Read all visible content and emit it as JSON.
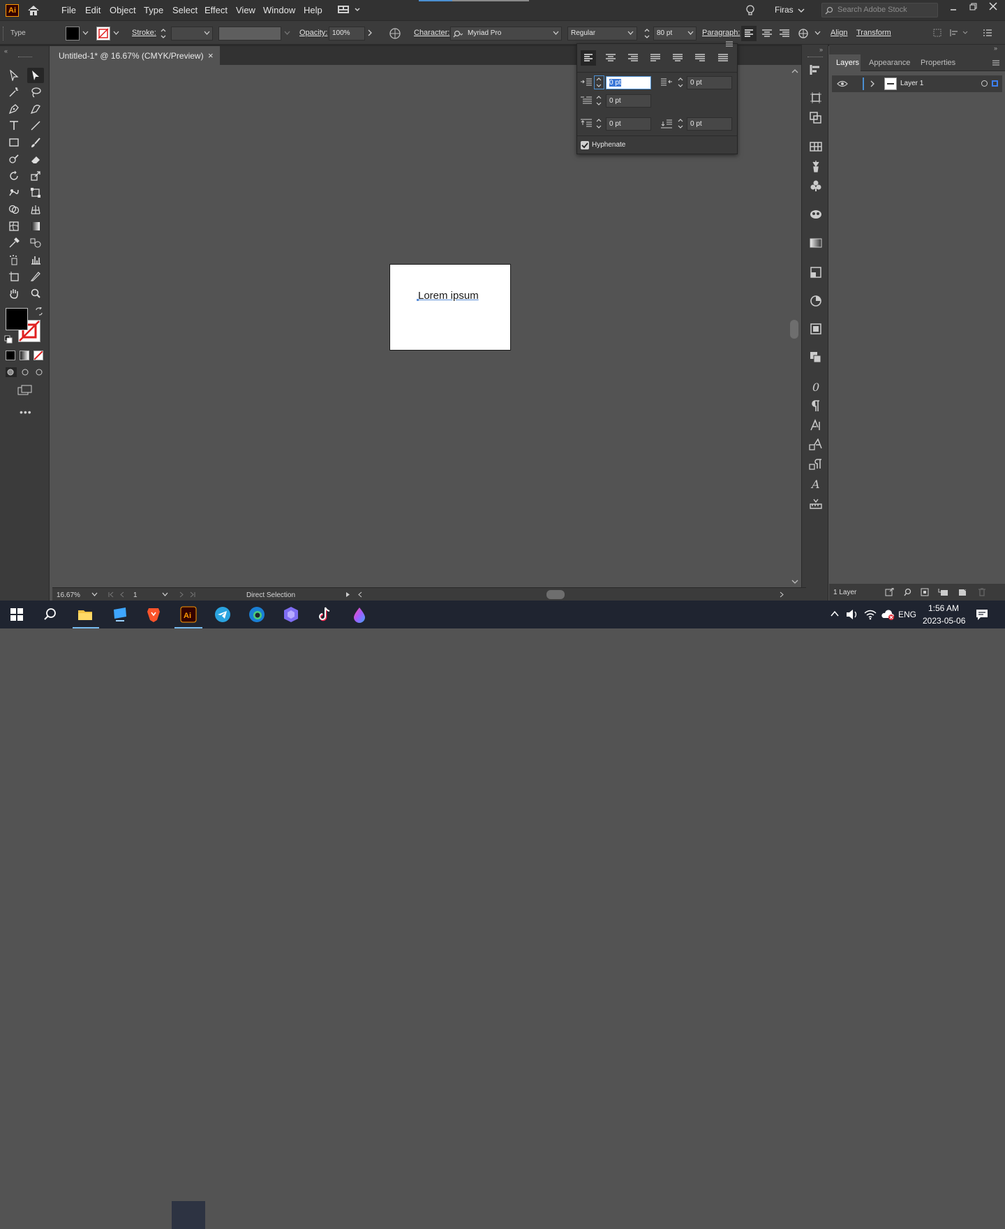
{
  "app": {
    "logo_text": "Ai"
  },
  "menu": [
    "File",
    "Edit",
    "Object",
    "Type",
    "Select",
    "Effect",
    "View",
    "Window",
    "Help"
  ],
  "user": {
    "name": "Firas"
  },
  "search": {
    "placeholder": "Search Adobe Stock"
  },
  "control_bar": {
    "mode_label": "Type",
    "stroke_label": "Stroke:",
    "opacity_label": "Opacity:",
    "opacity_value": "100%",
    "character_label": "Character:",
    "font_family": "Myriad Pro",
    "font_style": "Regular",
    "font_size": "80 pt",
    "paragraph_label": "Paragraph:",
    "align_label": "Align",
    "transform_label": "Transform"
  },
  "document": {
    "tab_title": "Untitled-1* @ 16.67% (CMYK/Preview)",
    "close": "×"
  },
  "artboard": {
    "text": "Lorem ipsum"
  },
  "paragraph_panel": {
    "left_indent": "0 pt",
    "right_indent": "0 pt",
    "first_line_indent": "0 pt",
    "space_before": "0 pt",
    "space_after": "0 pt",
    "hyphenate_label": "Hyphenate",
    "hyphenate_checked": true
  },
  "layers_panel": {
    "tabs": [
      "Layers",
      "Appearance",
      "Properties"
    ],
    "layer_name": "Layer 1",
    "footer_count": "1 Layer"
  },
  "status_bar": {
    "zoom": "16.67%",
    "artboard_num": "1",
    "tool": "Direct Selection"
  },
  "taskbar": {
    "language": "ENG",
    "time": "1:56 AM",
    "date": "2023-05-06"
  },
  "colors": {
    "accent": "#4b8fd1",
    "ai_orange": "#ff9a00",
    "panel": "#3b3b3b",
    "canvas": "#535353"
  }
}
